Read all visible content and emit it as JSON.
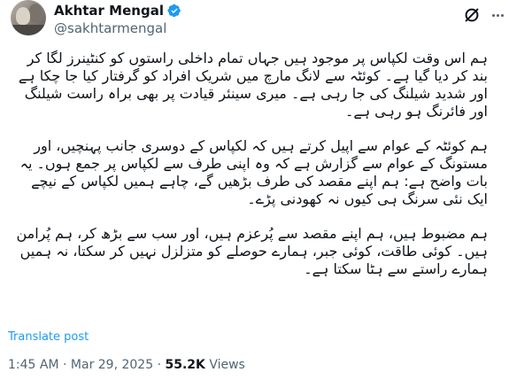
{
  "author": {
    "display_name": "Akhtar Mengal",
    "handle": "@sakhtarmengal"
  },
  "tweet": {
    "paragraphs": [
      "ہم اس وقت لکپاس پر موجود ہیں جہاں تمام داخلی راستوں کو کنٹینرز لگا کر بند کر دیا گیا ہے۔ کوئٹہ سے لانگ مارچ میں شریک افراد کو گرفتار کیا جا چکا ہے اور شدید شیلنگ کی جا رہی ہے۔ میری سینئر قیادت پر بھی براہ راست شیلنگ اور فائرنگ ہو رہی ہے۔",
      "ہم کوئٹہ کے عوام سے اپیل کرتے ہیں کہ لکپاس کے دوسری جانب پہنچیں، اور مستونگ کے عوام سے گزارش ہے کہ وہ اپنی طرف سے لکپاس پر جمع ہوں۔ یہ بات واضح ہے: ہم اپنے مقصد کی طرف بڑھیں گے، چاہے ہمیں لکپاس کے نیچے ایک نئی سرنگ ہی کیوں نہ کھودنی پڑے۔",
      "ہم مضبوط ہیں، ہم اپنے مقصد سے پُرعزم ہیں، اور سب سے بڑھ کر، ہم پُرامن ہیں۔ کوئی طاقت، کوئی جبر، ہمارے حوصلے کو متزلزل نہیں کر سکتا، نہ ہمیں ہمارے راستے سے ہٹا سکتا ہے۔"
    ],
    "translate_label": "Translate post",
    "time": "1:45 AM",
    "separator": "·",
    "date": "Mar 29, 2025",
    "views_count": "55.2K",
    "views_label": "Views"
  },
  "icons": {
    "verified": "verified-badge-icon",
    "grok": "grok-icon",
    "more": "more-options-icon"
  },
  "colors": {
    "accent": "#1d9bf0",
    "secondary_text": "#536471",
    "primary_text": "#0f1419"
  }
}
